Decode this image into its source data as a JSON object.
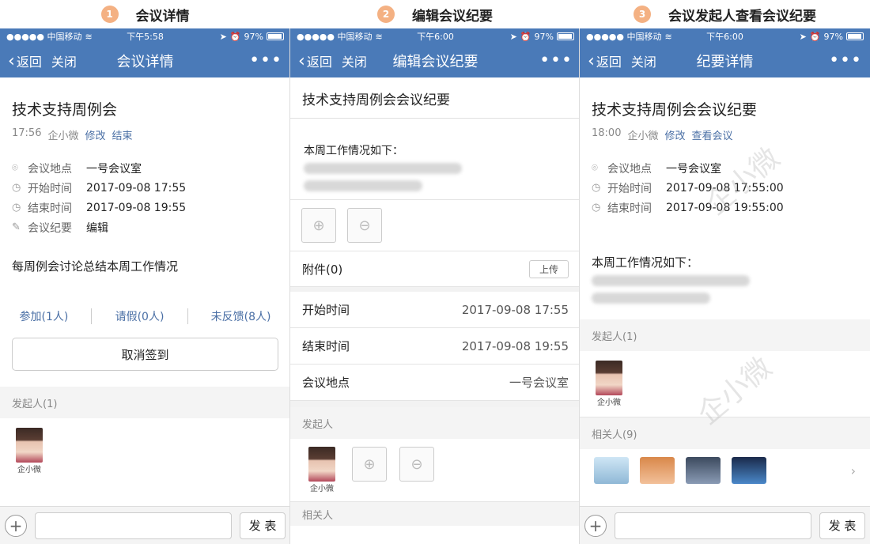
{
  "captions": [
    {
      "step": "1",
      "text": "会议详情"
    },
    {
      "step": "2",
      "text": "编辑会议纪要"
    },
    {
      "step": "3",
      "text": "会议发起人查看会议纪要"
    }
  ],
  "status": [
    {
      "carrier": "●●●●● 中国移动",
      "time": "下午5:58",
      "battery": "97%"
    },
    {
      "carrier": "●●●●● 中国移动",
      "time": "下午6:00",
      "battery": "97%"
    },
    {
      "carrier": "●●●●● 中国移动",
      "time": "下午6:00",
      "battery": "97%"
    }
  ],
  "nav": {
    "back": "返回",
    "close": "关闭",
    "more": "•••",
    "titles": [
      "会议详情",
      "编辑会议纪要",
      "纪要详情"
    ]
  },
  "screen1": {
    "title": "技术支持周例会",
    "meta_time": "17:56",
    "meta_user": "企小微",
    "modify": "修改",
    "end": "结束",
    "rows": [
      {
        "label": "会议地点",
        "value": "一号会议室"
      },
      {
        "label": "开始时间",
        "value": "2017-09-08 17:55"
      },
      {
        "label": "结束时间",
        "value": "2017-09-08 19:55"
      },
      {
        "label": "会议纪要",
        "value": "编辑"
      }
    ],
    "desc": "每周例会讨论总结本周工作情况",
    "rsvp": [
      "参加(1人)",
      "请假(0人)",
      "未反馈(8人)"
    ],
    "cancel": "取消签到",
    "organizer_head": "发起人(1)",
    "organizer_name": "企小微"
  },
  "screen2": {
    "title": "技术支持周例会会议纪要",
    "body_head": "本周工作情况如下：",
    "attach": "附件(0)",
    "upload": "上传",
    "rows": [
      {
        "label": "开始时间",
        "value": "2017-09-08 17:55"
      },
      {
        "label": "结束时间",
        "value": "2017-09-08 19:55"
      },
      {
        "label": "会议地点",
        "value": "一号会议室"
      }
    ],
    "organizer_head": "发起人",
    "organizer_name": "企小微",
    "related_head": "相关人"
  },
  "screen3": {
    "title": "技术支持周例会会议纪要",
    "meta_time": "18:00",
    "meta_user": "企小微",
    "modify": "修改",
    "view": "查看会议",
    "rows": [
      {
        "label": "会议地点",
        "value": "一号会议室"
      },
      {
        "label": "开始时间",
        "value": "2017-09-08 17:55:00"
      },
      {
        "label": "结束时间",
        "value": "2017-09-08 19:55:00"
      }
    ],
    "body_head": "本周工作情况如下：",
    "organizer_head": "发起人(1)",
    "organizer_name": "企小微",
    "related_head": "相关人(9)",
    "watermark": "企小微"
  },
  "send": "发 表"
}
